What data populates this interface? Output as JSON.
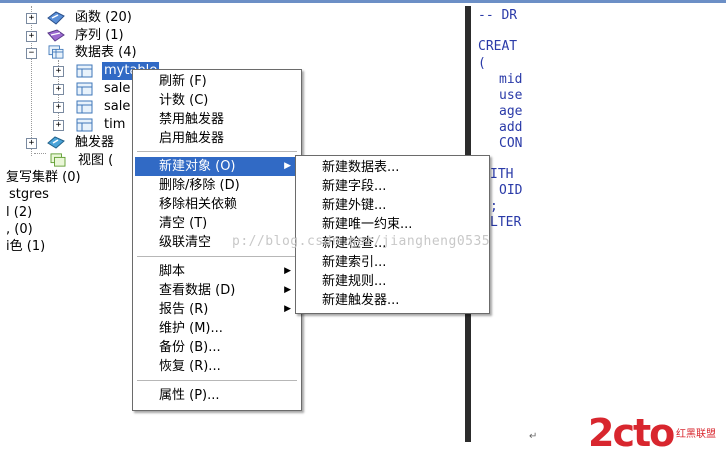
{
  "tree": {
    "functions": "函数 (20)",
    "sequences": "序列 (1)",
    "tables": "数据表 (4)",
    "table1": "mytable",
    "table2": "sale",
    "table3": "sale",
    "table4": "tim",
    "triggers": "触发器",
    "views": "视图 (",
    "replication": "复写集群 (0)",
    "postgres": "stgres",
    "item_a": "l (2)",
    "item_b": ", (0)",
    "item_c": "i色 (1)"
  },
  "editor": {
    "lines": [
      "-- DR",
      "CREAT",
      "(",
      "mid",
      "use",
      "age",
      "add",
      "CON",
      "ITH",
      "OID",
      ";",
      "LTER"
    ]
  },
  "context_menu": {
    "refresh": "刷新 (F)",
    "count": "计数 (C)",
    "disable_triggers": "禁用触发器",
    "enable_triggers": "启用触发器",
    "new_object": "新建对象 (O)",
    "delete": "删除/移除 (D)",
    "remove_deps": "移除相关依赖",
    "clear": "清空 (T)",
    "cascade_clear": "级联清空",
    "script": "脚本",
    "view_data": "查看数据 (D)",
    "report": "报告 (R)",
    "maintain": "维护 (M)...",
    "backup": "备份 (B)...",
    "restore": "恢复 (R)...",
    "properties": "属性 (P)..."
  },
  "submenu": {
    "new_table": "新建数据表...",
    "new_column": "新建字段...",
    "new_fk": "新建外键...",
    "new_unique": "新建唯一约束...",
    "new_check": "新建检查...",
    "new_index": "新建索引...",
    "new_rule": "新建规则...",
    "new_trigger": "新建触发器..."
  },
  "watermark": "p://blog.csdn.net/jiangheng0535",
  "logo": {
    "big": "2cto",
    "small": "红黑联盟"
  },
  "colors": {
    "highlight": "#316ac5",
    "logo": "#d8262e",
    "editor_text": "#2a3aa8"
  },
  "icons": {
    "function": "function-icon",
    "sequence": "sequence-icon",
    "tables": "tables-icon",
    "table": "table-icon",
    "trigger": "trigger-icon",
    "view": "view-icon",
    "submenu_arrow": "triangle-right-icon"
  }
}
